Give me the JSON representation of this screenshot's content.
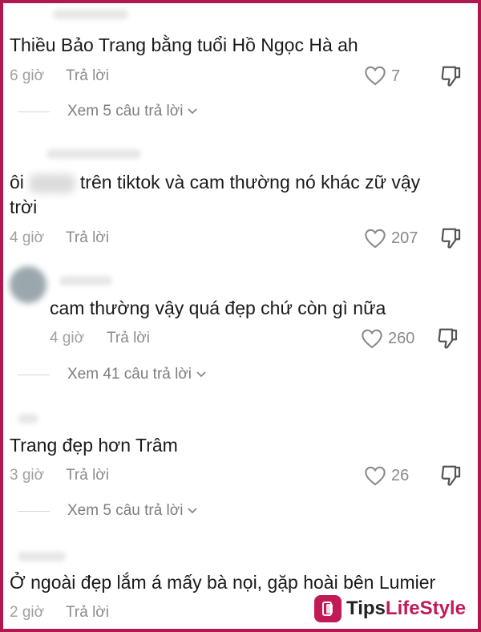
{
  "comments": [
    {
      "text": "Thiều Bảo Trang bằng tuổi Hồ Ngọc Hà ah",
      "time": "6 giờ",
      "reply": "Trả lời",
      "likes": "7"
    },
    {
      "text_before": "ôi",
      "text_after": "trên tiktok và cam thường nó khác zữ vậy",
      "text_line2": "trời",
      "time": "4 giờ",
      "reply": "Trả lời",
      "likes": "207"
    },
    {
      "text": "cam thường vậy quá đẹp chứ còn gì nữa",
      "time": "4 giờ",
      "reply": "Trả lời",
      "likes": "260"
    },
    {
      "text": "Trang đẹp hơn Trâm",
      "time": "3 giờ",
      "reply": "Trả lời",
      "likes": "26"
    },
    {
      "text": "Ở ngoài đẹp lắm á mấy bà nọi, gặp hoài bên Lumier",
      "time": "2 giờ",
      "reply": "Trả lời"
    }
  ],
  "threads": [
    {
      "label": "Xem 5 câu trả lời"
    },
    {
      "label": "Xem 41 câu trả lời"
    },
    {
      "label": "Xem 5 câu trả lời"
    }
  ],
  "brand": {
    "tips": "Tips",
    "lifestyle": "LifeStyle"
  },
  "colors": {
    "frame": "#b0194f",
    "brand": "#c21a57"
  },
  "icons": [
    "heart-icon",
    "dislike-icon",
    "chevron-down-icon"
  ]
}
